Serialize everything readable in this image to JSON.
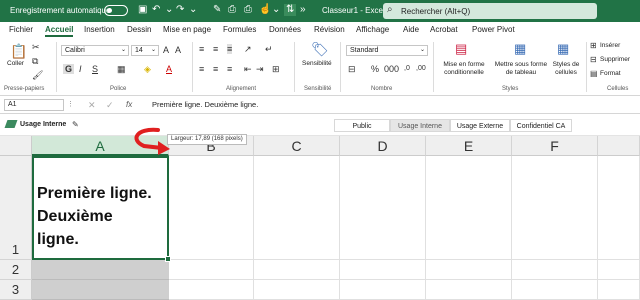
{
  "titlebar": {
    "autosave_label": "Enregistrement automatique",
    "toggle_state": "Désactivé",
    "document": "Classeur1 - Excel",
    "search_placeholder": "Rechercher (Alt+Q)"
  },
  "quick_access": [
    {
      "name": "save-icon",
      "glyph": "▣"
    },
    {
      "name": "undo-icon",
      "glyph": "↶"
    },
    {
      "name": "redo-icon",
      "glyph": "↷"
    },
    {
      "name": "brush-icon",
      "glyph": "✎"
    },
    {
      "name": "print-preview-icon",
      "glyph": "⎙"
    },
    {
      "name": "print-icon",
      "glyph": "⎙"
    },
    {
      "name": "touch-mode-icon",
      "glyph": "☝"
    },
    {
      "name": "customize-icon",
      "glyph": "⌄"
    },
    {
      "name": "sort-icon",
      "glyph": "⇅"
    }
  ],
  "tabs": [
    "Fichier",
    "Accueil",
    "Insertion",
    "Dessin",
    "Mise en page",
    "Formules",
    "Données",
    "Révision",
    "Affichage",
    "Aide",
    "Acrobat",
    "Power Pivot"
  ],
  "ribbon": {
    "paste_label": "Coller",
    "font_name": "Calibri",
    "font_size": "14",
    "format_number": "Standard",
    "sensitivity_label": "Sensibilité",
    "conditional_format": "Mise en forme conditionnelle",
    "format_as_table": "Mettre sous forme de tableau",
    "cell_styles": "Styles de cellules",
    "insert": "Insérer",
    "delete": "Supprimer",
    "format": "Format",
    "groups": [
      "Presse-papiers",
      "Police",
      "Alignement",
      "Sensibilité",
      "Nombre",
      "Styles",
      "Cellules"
    ]
  },
  "formula_bar": {
    "name_box": "A1",
    "fx": "fx",
    "content": "Première ligne. Deuxième ligne."
  },
  "sensitivity": {
    "current": "Usage Interne",
    "options": [
      "Public",
      "Usage Interne",
      "Usage Externe",
      "Confidentiel CA"
    ]
  },
  "grid": {
    "columns": [
      "A",
      "B",
      "C",
      "D",
      "E",
      "F"
    ],
    "rows": [
      "1",
      "2",
      "3"
    ],
    "a1_lines": [
      "Première ligne.",
      "Deuxième",
      "ligne."
    ]
  },
  "tooltip": "Largeur: 17,89 (168 pixels)",
  "colors": {
    "brand": "#217346",
    "accent": "#1e6b3e",
    "arrow": "#e02020"
  }
}
